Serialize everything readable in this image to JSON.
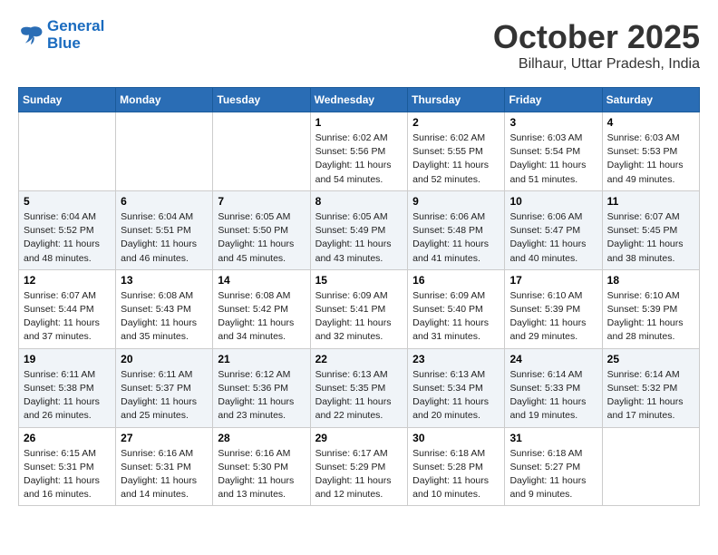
{
  "header": {
    "logo_line1": "General",
    "logo_line2": "Blue",
    "month": "October 2025",
    "location": "Bilhaur, Uttar Pradesh, India"
  },
  "weekdays": [
    "Sunday",
    "Monday",
    "Tuesday",
    "Wednesday",
    "Thursday",
    "Friday",
    "Saturday"
  ],
  "weeks": [
    [
      {
        "day": "",
        "info": ""
      },
      {
        "day": "",
        "info": ""
      },
      {
        "day": "",
        "info": ""
      },
      {
        "day": "1",
        "info": "Sunrise: 6:02 AM\nSunset: 5:56 PM\nDaylight: 11 hours\nand 54 minutes."
      },
      {
        "day": "2",
        "info": "Sunrise: 6:02 AM\nSunset: 5:55 PM\nDaylight: 11 hours\nand 52 minutes."
      },
      {
        "day": "3",
        "info": "Sunrise: 6:03 AM\nSunset: 5:54 PM\nDaylight: 11 hours\nand 51 minutes."
      },
      {
        "day": "4",
        "info": "Sunrise: 6:03 AM\nSunset: 5:53 PM\nDaylight: 11 hours\nand 49 minutes."
      }
    ],
    [
      {
        "day": "5",
        "info": "Sunrise: 6:04 AM\nSunset: 5:52 PM\nDaylight: 11 hours\nand 48 minutes."
      },
      {
        "day": "6",
        "info": "Sunrise: 6:04 AM\nSunset: 5:51 PM\nDaylight: 11 hours\nand 46 minutes."
      },
      {
        "day": "7",
        "info": "Sunrise: 6:05 AM\nSunset: 5:50 PM\nDaylight: 11 hours\nand 45 minutes."
      },
      {
        "day": "8",
        "info": "Sunrise: 6:05 AM\nSunset: 5:49 PM\nDaylight: 11 hours\nand 43 minutes."
      },
      {
        "day": "9",
        "info": "Sunrise: 6:06 AM\nSunset: 5:48 PM\nDaylight: 11 hours\nand 41 minutes."
      },
      {
        "day": "10",
        "info": "Sunrise: 6:06 AM\nSunset: 5:47 PM\nDaylight: 11 hours\nand 40 minutes."
      },
      {
        "day": "11",
        "info": "Sunrise: 6:07 AM\nSunset: 5:45 PM\nDaylight: 11 hours\nand 38 minutes."
      }
    ],
    [
      {
        "day": "12",
        "info": "Sunrise: 6:07 AM\nSunset: 5:44 PM\nDaylight: 11 hours\nand 37 minutes."
      },
      {
        "day": "13",
        "info": "Sunrise: 6:08 AM\nSunset: 5:43 PM\nDaylight: 11 hours\nand 35 minutes."
      },
      {
        "day": "14",
        "info": "Sunrise: 6:08 AM\nSunset: 5:42 PM\nDaylight: 11 hours\nand 34 minutes."
      },
      {
        "day": "15",
        "info": "Sunrise: 6:09 AM\nSunset: 5:41 PM\nDaylight: 11 hours\nand 32 minutes."
      },
      {
        "day": "16",
        "info": "Sunrise: 6:09 AM\nSunset: 5:40 PM\nDaylight: 11 hours\nand 31 minutes."
      },
      {
        "day": "17",
        "info": "Sunrise: 6:10 AM\nSunset: 5:39 PM\nDaylight: 11 hours\nand 29 minutes."
      },
      {
        "day": "18",
        "info": "Sunrise: 6:10 AM\nSunset: 5:39 PM\nDaylight: 11 hours\nand 28 minutes."
      }
    ],
    [
      {
        "day": "19",
        "info": "Sunrise: 6:11 AM\nSunset: 5:38 PM\nDaylight: 11 hours\nand 26 minutes."
      },
      {
        "day": "20",
        "info": "Sunrise: 6:11 AM\nSunset: 5:37 PM\nDaylight: 11 hours\nand 25 minutes."
      },
      {
        "day": "21",
        "info": "Sunrise: 6:12 AM\nSunset: 5:36 PM\nDaylight: 11 hours\nand 23 minutes."
      },
      {
        "day": "22",
        "info": "Sunrise: 6:13 AM\nSunset: 5:35 PM\nDaylight: 11 hours\nand 22 minutes."
      },
      {
        "day": "23",
        "info": "Sunrise: 6:13 AM\nSunset: 5:34 PM\nDaylight: 11 hours\nand 20 minutes."
      },
      {
        "day": "24",
        "info": "Sunrise: 6:14 AM\nSunset: 5:33 PM\nDaylight: 11 hours\nand 19 minutes."
      },
      {
        "day": "25",
        "info": "Sunrise: 6:14 AM\nSunset: 5:32 PM\nDaylight: 11 hours\nand 17 minutes."
      }
    ],
    [
      {
        "day": "26",
        "info": "Sunrise: 6:15 AM\nSunset: 5:31 PM\nDaylight: 11 hours\nand 16 minutes."
      },
      {
        "day": "27",
        "info": "Sunrise: 6:16 AM\nSunset: 5:31 PM\nDaylight: 11 hours\nand 14 minutes."
      },
      {
        "day": "28",
        "info": "Sunrise: 6:16 AM\nSunset: 5:30 PM\nDaylight: 11 hours\nand 13 minutes."
      },
      {
        "day": "29",
        "info": "Sunrise: 6:17 AM\nSunset: 5:29 PM\nDaylight: 11 hours\nand 12 minutes."
      },
      {
        "day": "30",
        "info": "Sunrise: 6:18 AM\nSunset: 5:28 PM\nDaylight: 11 hours\nand 10 minutes."
      },
      {
        "day": "31",
        "info": "Sunrise: 6:18 AM\nSunset: 5:27 PM\nDaylight: 11 hours\nand 9 minutes."
      },
      {
        "day": "",
        "info": ""
      }
    ]
  ]
}
